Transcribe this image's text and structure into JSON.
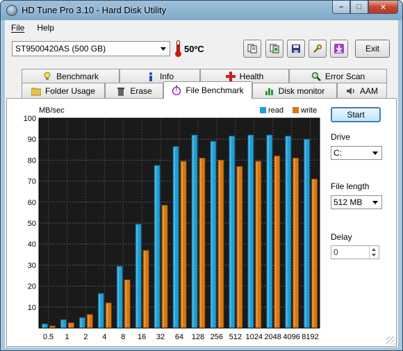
{
  "window": {
    "title": "HD Tune Pro 3.10 - Hard Disk Utility"
  },
  "title_buttons": {
    "minimize": "–",
    "maximize": "□",
    "close": "✕"
  },
  "menu": {
    "file": "File",
    "help": "Help"
  },
  "toolbar": {
    "drive": "ST9500420AS (500 GB)",
    "temperature": "50ºC",
    "exit_label": "Exit"
  },
  "tabs": {
    "row_top": [
      "Benchmark",
      "Info",
      "Health",
      "Error Scan"
    ],
    "row_bottom": [
      "Folder Usage",
      "Erase",
      "File Benchmark",
      "Disk monitor",
      "AAM"
    ],
    "active": "File Benchmark"
  },
  "side": {
    "start_label": "Start",
    "drive_label": "Drive",
    "drive_value": "C:",
    "file_length_label": "File length",
    "file_length_value": "512 MB",
    "delay_label": "Delay",
    "delay_value": "0"
  },
  "colors": {
    "read": "#1f9fd4",
    "write": "#d9780f",
    "plot_bg": "#1a1a1a",
    "accent": "#3c7fb1"
  },
  "chart_data": {
    "type": "bar",
    "ylabel": "MB/sec",
    "ylim": [
      0,
      100
    ],
    "yticks": [
      10,
      20,
      30,
      40,
      50,
      60,
      70,
      80,
      90,
      100
    ],
    "grid": true,
    "legend": "top-right",
    "categories": [
      "0.5",
      "1",
      "2",
      "4",
      "8",
      "16",
      "32",
      "64",
      "128",
      "256",
      "512",
      "1024",
      "2048",
      "4096",
      "8192"
    ],
    "series": [
      {
        "name": "read",
        "values": [
          2,
          4,
          5,
          16.5,
          29.5,
          49.5,
          77.5,
          86.5,
          92,
          89,
          91.5,
          92,
          92,
          91.5,
          90
        ]
      },
      {
        "name": "write",
        "values": [
          1,
          2.5,
          6.5,
          12,
          23,
          37,
          58.5,
          79.5,
          81,
          80,
          77,
          79.5,
          82,
          81,
          71
        ]
      }
    ]
  }
}
